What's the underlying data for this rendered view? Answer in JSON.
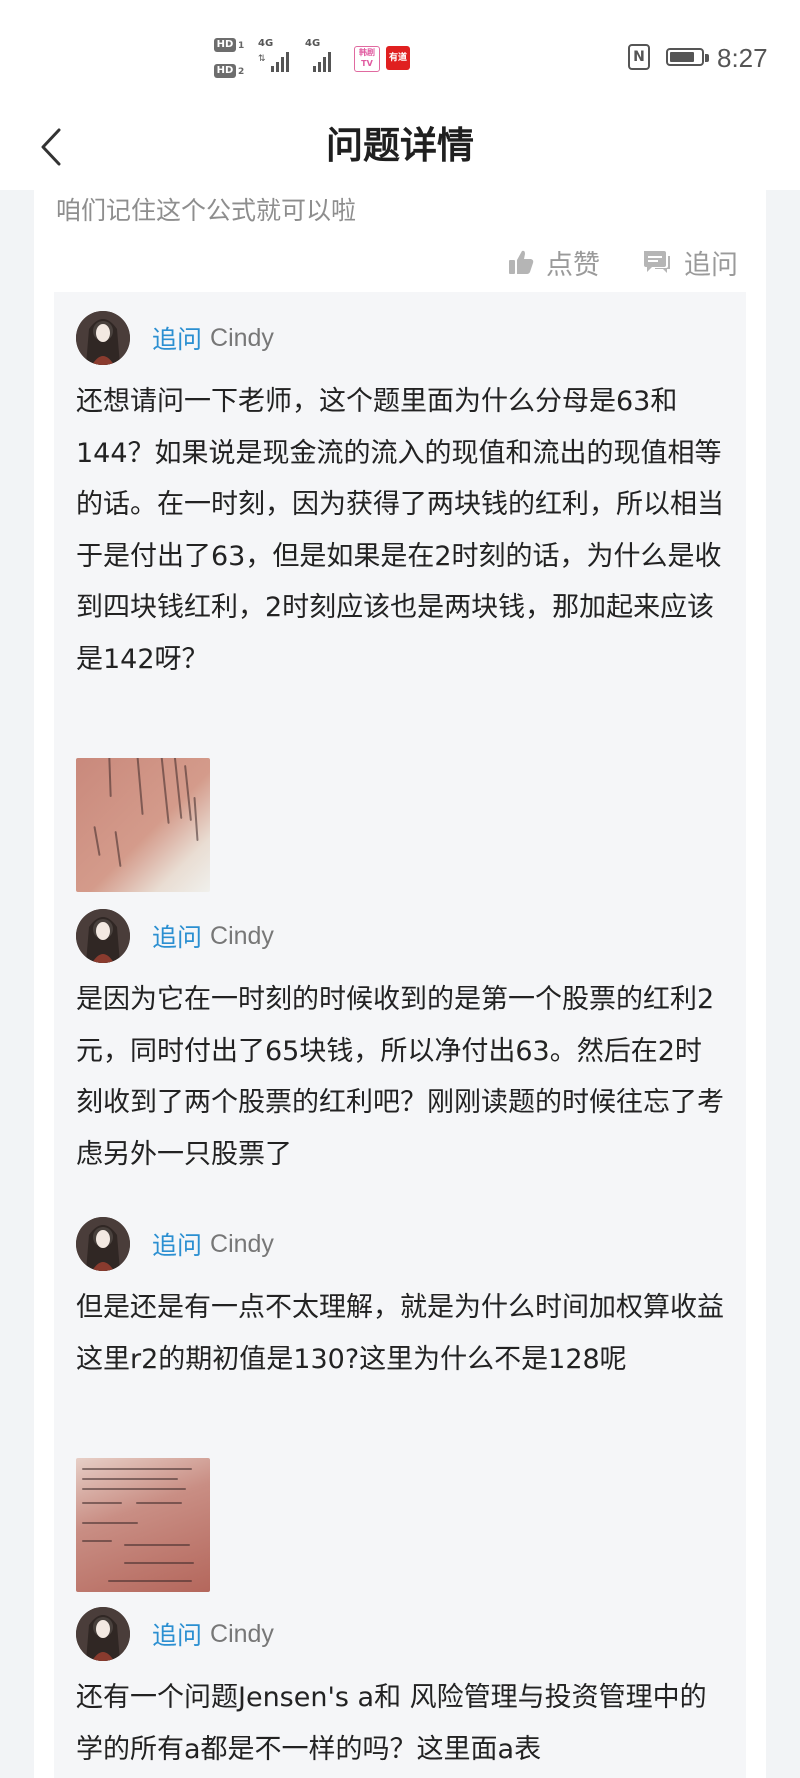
{
  "status_bar": {
    "hd1": "HD",
    "hd1_sub": "1",
    "hd2": "HD",
    "hd2_sub": "2",
    "sim1_network": "4G",
    "sim2_network": "4G",
    "app_icon_1": "韩剧TV",
    "app_icon_2": "有道",
    "nfc_label": "N",
    "battery_level": 0.8,
    "time": "8:27"
  },
  "nav": {
    "back_icon": "chevron-left-icon",
    "title": "问题详情"
  },
  "answer": {
    "snippet": "咱们记住这个公式就可以啦",
    "like_label": "点赞",
    "follow_up_label": "追问"
  },
  "followups": [
    {
      "tag": "追问",
      "user": "Cindy",
      "text": "还想请问一下老师，这个题里面为什么分母是63和144？如果说是现金流的流入的现值和流出的现值相等的话。在一时刻，因为获得了两块钱的红利，所以相当于是付出了63，但是如果是在2时刻的话，为什么是收到四块钱红利，2时刻应该也是两块钱，那加起来应该是142呀？",
      "has_image": true
    },
    {
      "tag": "追问",
      "user": "Cindy",
      "text": "是因为它在一时刻的时候收到的是第一个股票的红利2元，同时付出了65块钱，所以净付出63。然后在2时刻收到了两个股票的红利吧？刚刚读题的时候往忘了考虑另外一只股票了",
      "has_image": false
    },
    {
      "tag": "追问",
      "user": "Cindy",
      "text": "但是还是有一点不太理解，就是为什么时间加权算收益这里r2的期初值是130?这里为什么不是128呢",
      "has_image": true
    },
    {
      "tag": "追问",
      "user": "Cindy",
      "text": "还有一个问题Jensen's a和 风险管理与投资管理中的学的所有a都是不一样的吗？这里面a表",
      "has_image": false
    }
  ],
  "colors": {
    "accent_blue": "#2b8fd1",
    "page_bg": "#f2f4f6",
    "followup_bg": "#f5f6f8",
    "muted_text": "#8e8e8e"
  }
}
